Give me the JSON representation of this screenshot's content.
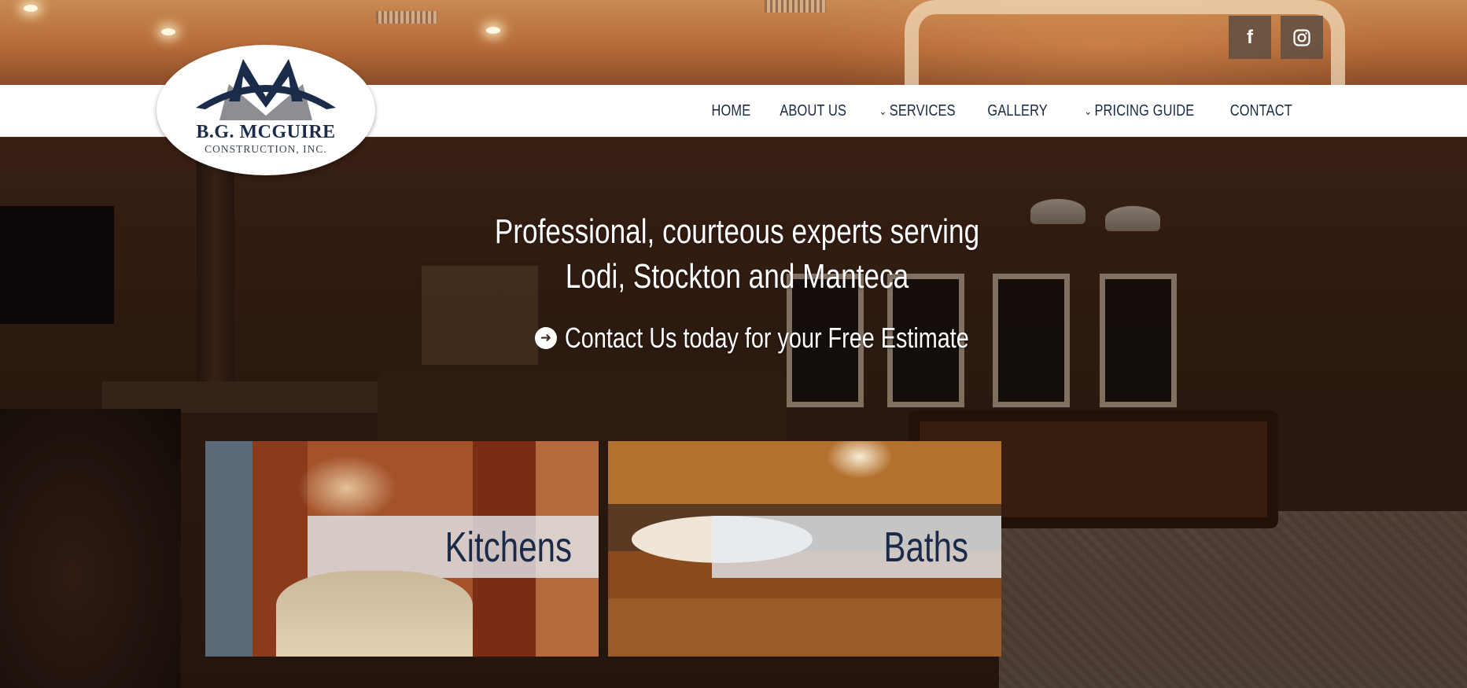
{
  "brand": {
    "logo_name": "B.G. MCGUIRE",
    "logo_sub": "CONSTRUCTION, INC.",
    "colors": {
      "navy": "#1b2b4a",
      "gray": "#8c8e93"
    }
  },
  "social": {
    "facebook_icon": "facebook-icon",
    "instagram_icon": "instagram-icon",
    "facebook_glyph": "f"
  },
  "nav": {
    "items": [
      {
        "label": "HOME",
        "dropdown": false
      },
      {
        "label": "ABOUT US",
        "dropdown": false
      },
      {
        "label": "SERVICES",
        "dropdown": true
      },
      {
        "label": "GALLERY",
        "dropdown": false
      },
      {
        "label": "PRICING GUIDE",
        "dropdown": true
      },
      {
        "label": "CONTACT",
        "dropdown": false
      }
    ]
  },
  "hero": {
    "headline_line1": "Professional, courteous experts serving",
    "headline_line2": "Lodi, Stockton and Manteca",
    "cta_text": "Contact Us today for your Free Estimate",
    "cta_icon": "arrow-right-circle-icon"
  },
  "cards": [
    {
      "label": "Kitchens"
    },
    {
      "label": "Baths"
    }
  ]
}
